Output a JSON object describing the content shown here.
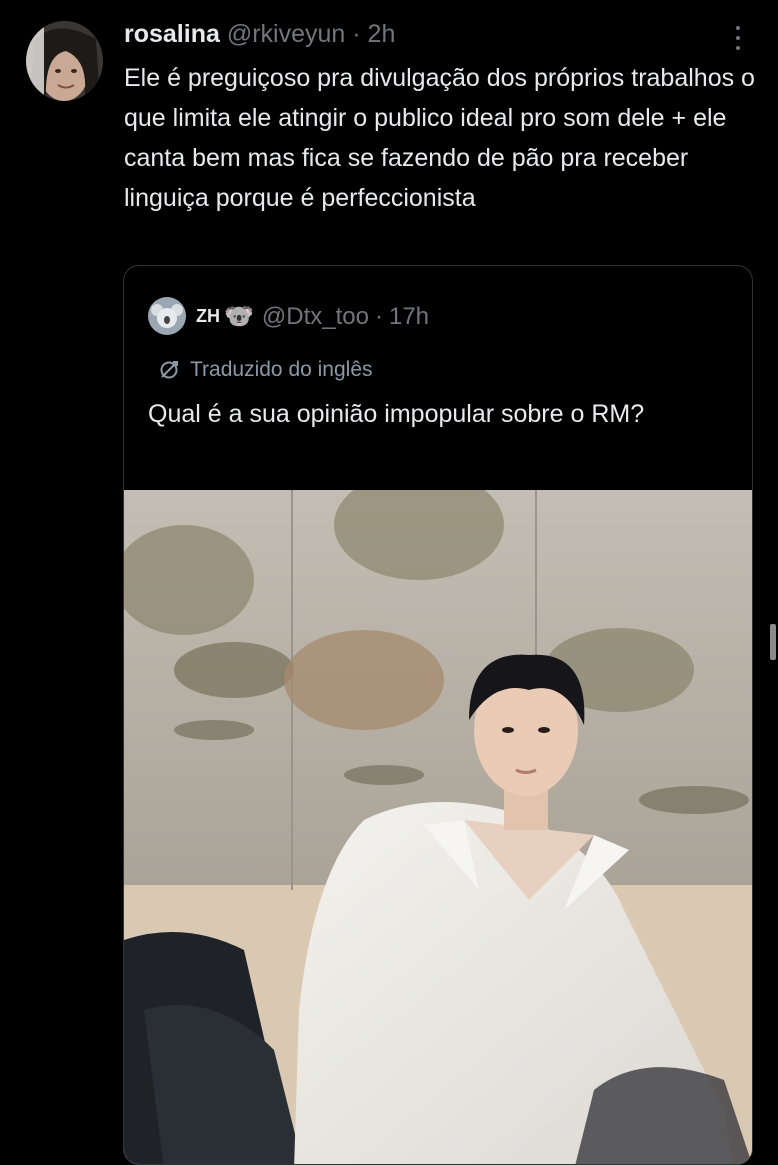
{
  "tweet": {
    "author_name": "rosalina",
    "author_handle": "@rkiveyun",
    "separator": "·",
    "time": "2h",
    "text": "Ele é preguiçoso pra divulgação dos próprios trabalhos o que limita ele atingir o publico ideal pro som dele + ele canta bem mas fica se fazendo de pão pra receber linguiça porque é perfeccionista"
  },
  "quoted_tweet": {
    "author_name": "ZH",
    "author_emoji": "🐨",
    "author_handle": "@Dtx_too",
    "separator": "·",
    "time": "17h",
    "translated_label": "Traduzido do inglês",
    "text": "Qual é a sua opinião impopular sobre o RM?"
  },
  "icons": {
    "more": "more-vertical-icon",
    "translate": "translate-icon",
    "avatar": "avatar",
    "image": "photo"
  },
  "colors": {
    "background": "#000000",
    "text": "#e7e9ea",
    "secondary": "#71767b",
    "border": "#2f3336"
  }
}
